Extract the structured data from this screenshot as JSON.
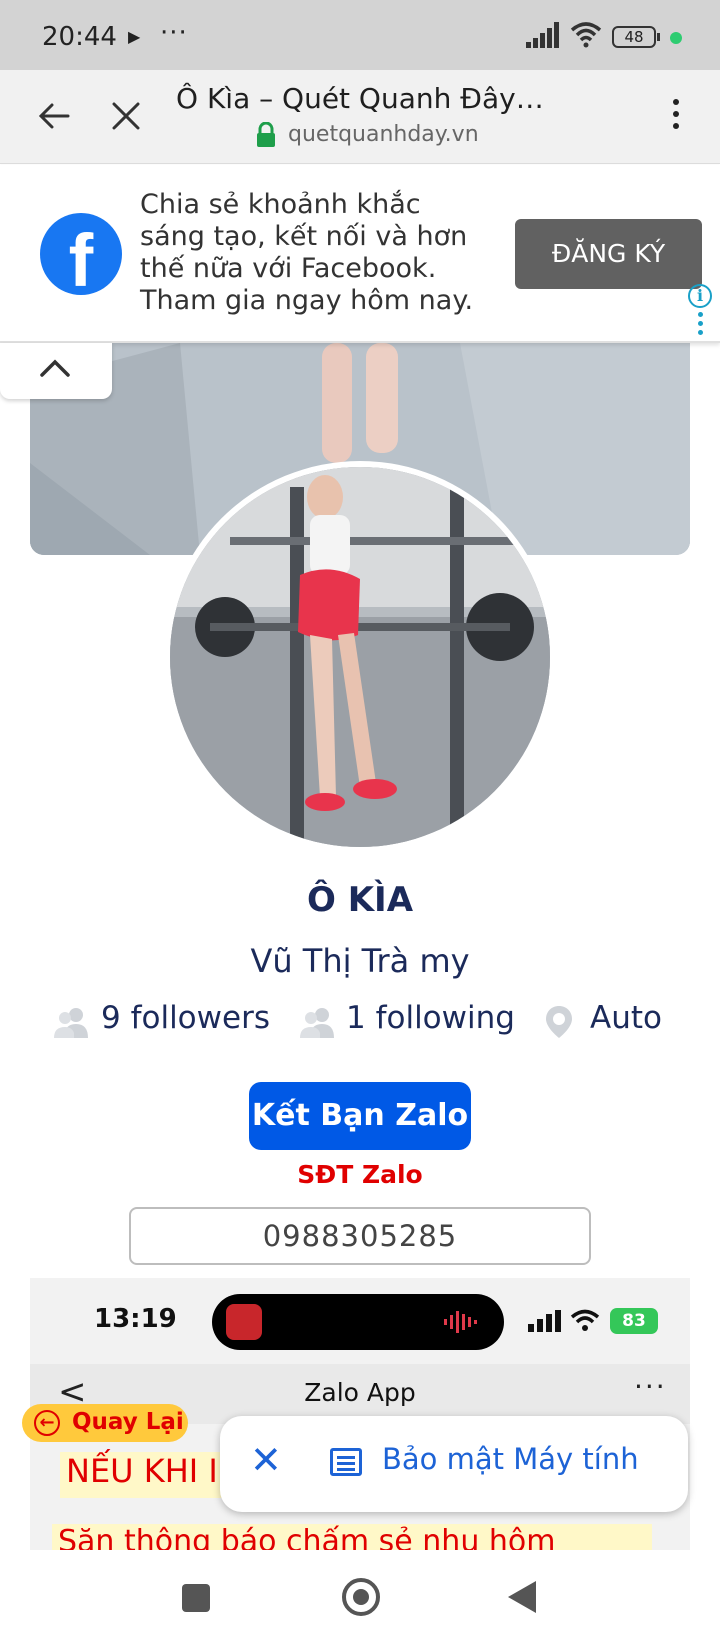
{
  "status_bar": {
    "time": "20:44",
    "battery": "48"
  },
  "browser": {
    "title": "Ô Kìa – Quét Quanh Đây…",
    "url": "quetquanhday.vn"
  },
  "ad": {
    "text": "Chia sẻ khoảnh khắc sáng tạo, kết nối và hơn thế nữa với Facebook. Tham gia ngay hôm nay.",
    "button_label": "ĐĂNG KÝ",
    "brand_color": "#1877f2"
  },
  "profile": {
    "name": "Ô KÌA",
    "subname": "Vũ Thị Trà my",
    "followers": "9 followers",
    "following": "1 following",
    "location": "Auto",
    "zalo_button": "Kết Bạn Zalo",
    "sdt_label": "SĐT Zalo",
    "phone": "0988305285"
  },
  "embedded_screenshot": {
    "time": "13:19",
    "battery": "83",
    "nav_back": "<",
    "nav_title": "Zalo App",
    "nav_more": "···",
    "red_line_1": "NẾU KHI I",
    "red_line_2": "Săn thông báo chấm sẻ nhu hôm"
  },
  "overlays": {
    "back_button": "Quay Lại",
    "security_label": "Bảo mật Máy tính"
  },
  "icons": {
    "back": "arrow-left-icon",
    "close": "close-icon",
    "lock": "lock-icon",
    "menu": "kebab-menu-icon",
    "info": "info-icon",
    "collapse": "chevron-up-icon",
    "followers": "people-icon",
    "location": "location-pin-icon"
  }
}
